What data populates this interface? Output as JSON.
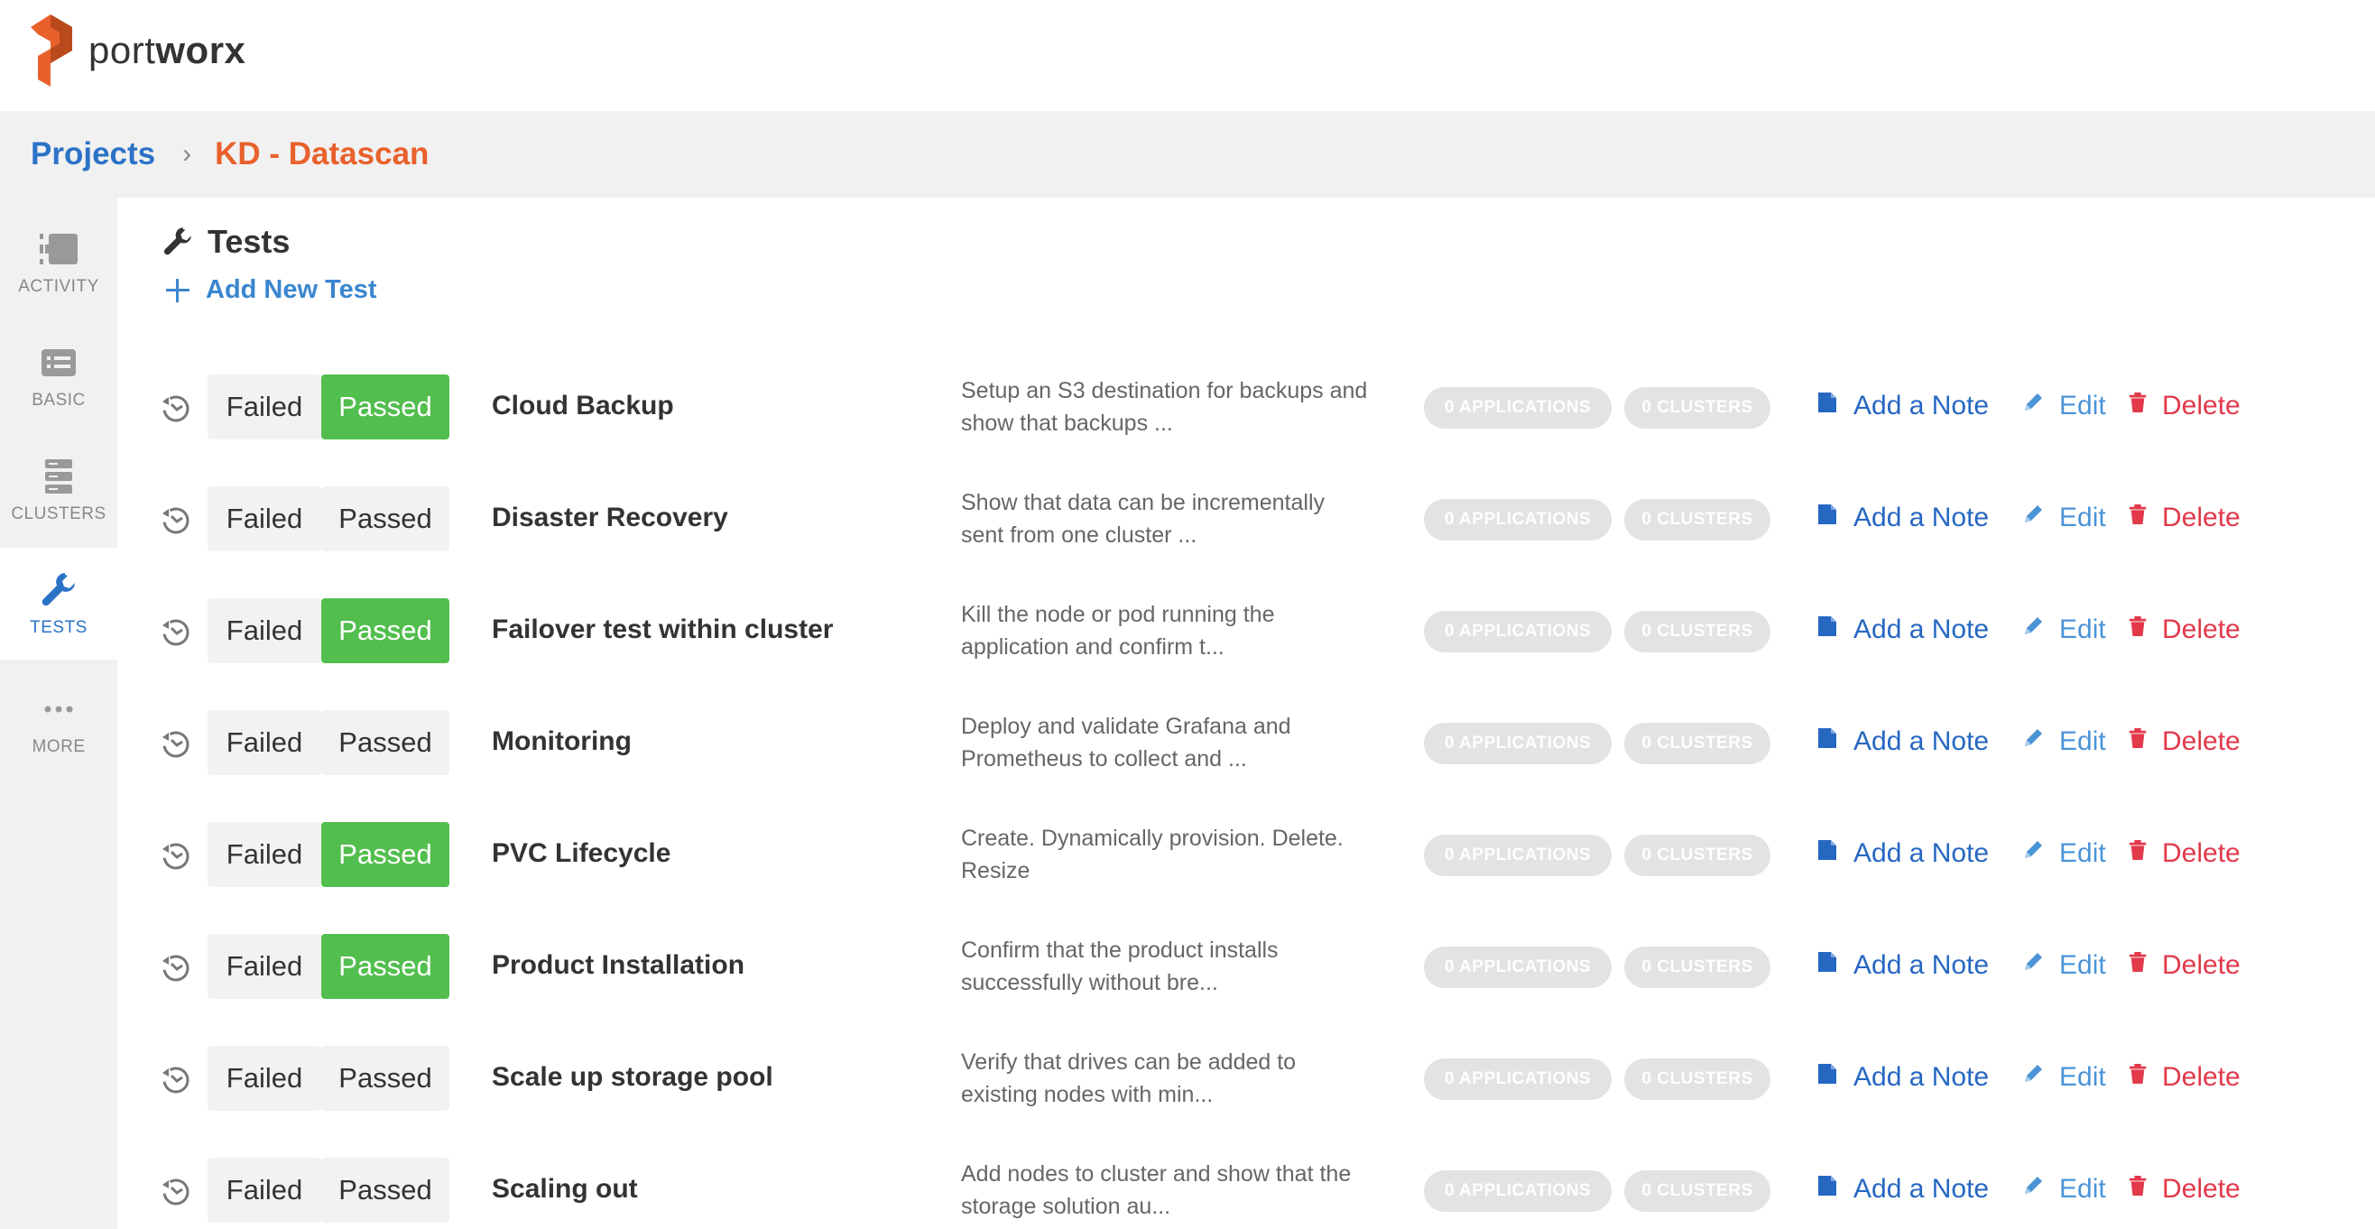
{
  "brand": {
    "name_light": "port",
    "name_bold": "worx",
    "color": "#e8612c"
  },
  "breadcrumb": {
    "parent": "Projects",
    "current": "KD - Datascan"
  },
  "sidebar": {
    "items": [
      {
        "label": "ACTIVITY",
        "icon": "activity-icon",
        "active": false
      },
      {
        "label": "BASIC",
        "icon": "card-icon",
        "active": false
      },
      {
        "label": "CLUSTERS",
        "icon": "server-icon",
        "active": false
      },
      {
        "label": "TESTS",
        "icon": "wrench-icon",
        "active": true
      },
      {
        "label": "MORE",
        "icon": "more-icon",
        "active": false
      }
    ]
  },
  "page": {
    "title": "Tests",
    "add_label": "Add New Test"
  },
  "labels": {
    "failed": "Failed",
    "passed": "Passed",
    "applications": "0 APPLICATIONS",
    "clusters": "0 CLUSTERS",
    "add_note": "Add a Note",
    "edit": "Edit",
    "delete": "Delete"
  },
  "tests": [
    {
      "name": "Cloud Backup",
      "desc1": "Setup an S3 destination for backups and",
      "desc2": "show that backups ...",
      "passed": true
    },
    {
      "name": "Disaster Recovery",
      "desc1": "Show that data can be incrementally",
      "desc2": "sent from one cluster ...",
      "passed": false
    },
    {
      "name": "Failover test within cluster",
      "desc1": "Kill the node or pod running the",
      "desc2": "application and confirm t...",
      "passed": true
    },
    {
      "name": "Monitoring",
      "desc1": "Deploy and validate Grafana and",
      "desc2": "Prometheus to collect and ...",
      "passed": false
    },
    {
      "name": "PVC Lifecycle",
      "desc1": "Create. Dynamically provision. Delete.",
      "desc2": "Resize",
      "passed": true
    },
    {
      "name": "Product Installation",
      "desc1": "Confirm that the product installs",
      "desc2": "successfully without bre...",
      "passed": true
    },
    {
      "name": "Scale up storage pool",
      "desc1": "Verify that drives can be added to",
      "desc2": "existing nodes with min...",
      "passed": false
    },
    {
      "name": "Scaling out",
      "desc1": "Add nodes to cluster and show that the",
      "desc2": "storage solution au...",
      "passed": false
    }
  ],
  "colors": {
    "passed": "#52be4e",
    "link": "#2b73c7",
    "delete": "#e2394b",
    "accent": "#e8612c"
  }
}
